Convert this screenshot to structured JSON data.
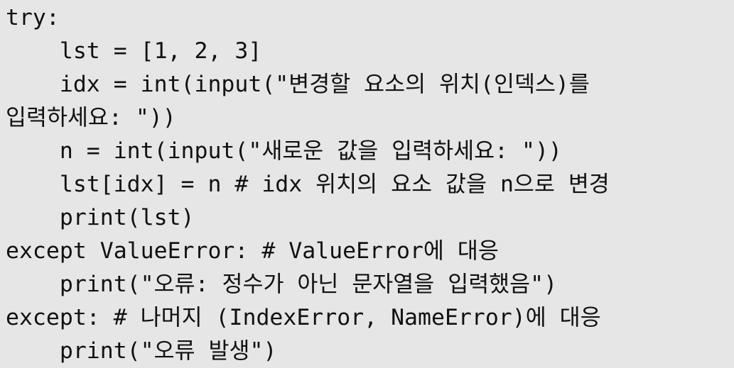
{
  "code": {
    "lines": [
      "try:",
      "    lst = [1, 2, 3]",
      "    idx = int(input(\"변경할 요소의 위치(인덱스)를",
      "입력하세요: \"))",
      "    n = int(input(\"새로운 값을 입력하세요: \"))",
      "    lst[idx] = n # idx 위치의 요소 값을 n으로 변경",
      "    print(lst)",
      "except ValueError: # ValueError에 대응",
      "    print(\"오류: 정수가 아닌 문자열을 입력했음\")",
      "except: # 나머지 (IndexError, NameError)에 대응",
      "    print(\"오류 발생\")"
    ]
  }
}
